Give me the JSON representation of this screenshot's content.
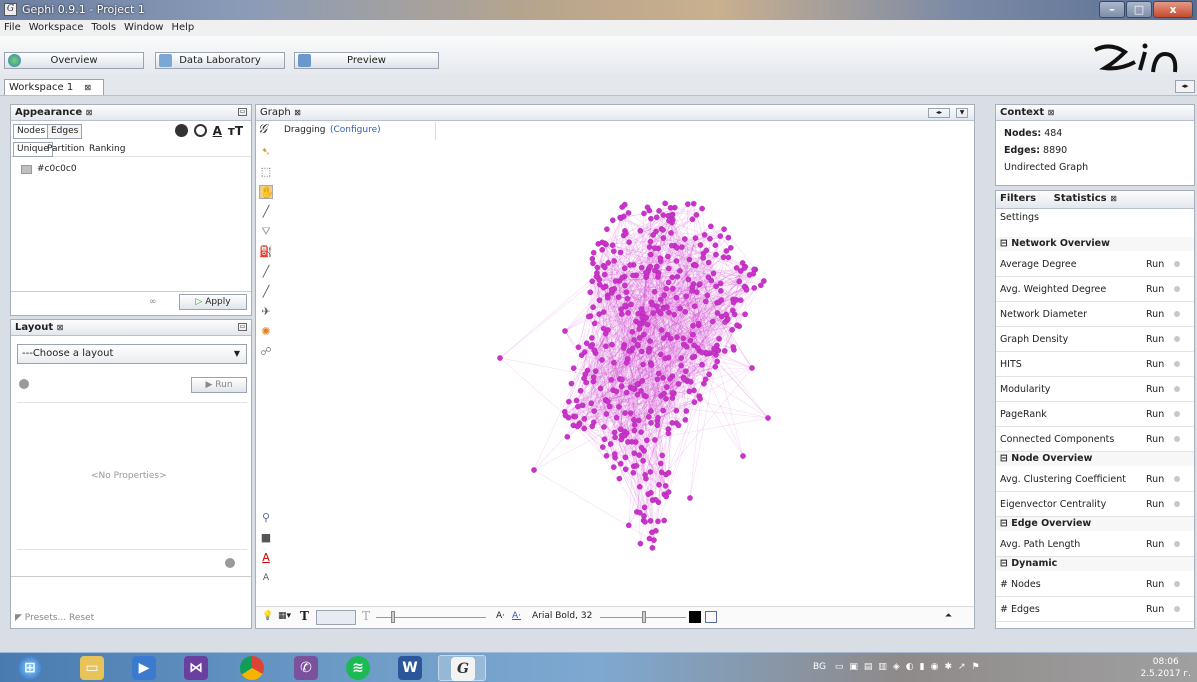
{
  "window": {
    "title": "Gephi 0.9.1 - Project 1",
    "app_icon": "gephi-icon",
    "controls": [
      "–",
      "□",
      "x"
    ]
  },
  "menu": [
    "File",
    "Workspace",
    "Tools",
    "Window",
    "Help"
  ],
  "modes": {
    "overview": "Overview",
    "data_lab": "Data Laboratory",
    "preview": "Preview"
  },
  "workspace_tab": "Workspace 1",
  "appearance": {
    "title": "Appearance",
    "tab_nodes": "Nodes",
    "tab_edges": "Edges",
    "mode_unique": "Unique",
    "mode_partition": "Partition",
    "mode_ranking": "Ranking",
    "color_value": "#c0c0c0",
    "apply": "Apply",
    "icon_text": "A",
    "icon_size": "тT"
  },
  "layout": {
    "title": "Layout",
    "choose": "---Choose a layout",
    "run": "Run",
    "no_props": "<No Properties>",
    "presets": "Presets...",
    "reset": "Reset"
  },
  "graph": {
    "tab": "Graph",
    "mode": "Dragging",
    "configure": "(Configure)",
    "node_color": "#cc33cc",
    "font_label": "Arial Bold, 32",
    "font_a_small": "A·",
    "font_a_color": "A·",
    "text_tool": "T"
  },
  "context": {
    "title": "Context",
    "nodes_label": "Nodes:",
    "nodes_value": "484",
    "edges_label": "Edges:",
    "edges_value": "8890",
    "graph_type": "Undirected Graph"
  },
  "statistics": {
    "filters_tab": "Filters",
    "statistics_tab": "Statistics",
    "settings": "Settings",
    "run_label": "Run",
    "network_overview": "Network Overview",
    "network_items": [
      "Average Degree",
      "Avg. Weighted Degree",
      "Network Diameter",
      "Graph Density",
      "HITS",
      "Modularity",
      "PageRank",
      "Connected Components"
    ],
    "node_overview": "Node Overview",
    "node_items": [
      "Avg. Clustering Coefficient",
      "Eigenvector Centrality"
    ],
    "edge_overview": "Edge Overview",
    "edge_items": [
      "Avg. Path Length"
    ],
    "dynamic": "Dynamic",
    "dynamic_items": [
      "# Nodes",
      "# Edges"
    ]
  },
  "taskbar": {
    "lang": "BG",
    "time": "08:06",
    "date": "2.5.2017 г."
  }
}
